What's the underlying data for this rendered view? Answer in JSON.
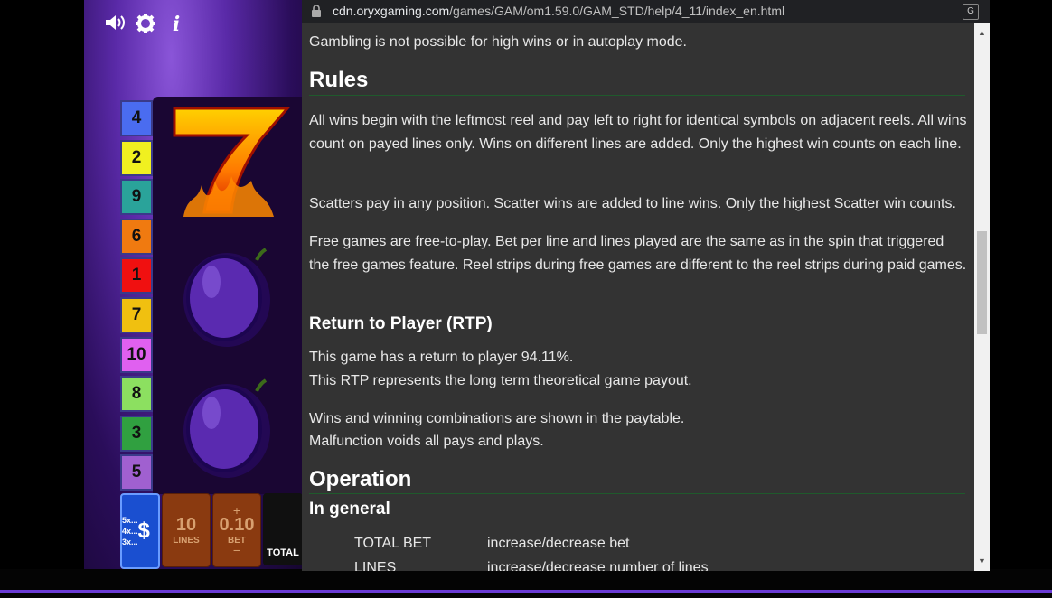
{
  "game": {
    "line_numbers": [
      {
        "label": "4",
        "color": "#4a6cf0"
      },
      {
        "label": "2",
        "color": "#f0f020"
      },
      {
        "label": "9",
        "color": "#2aa39a"
      },
      {
        "label": "6",
        "color": "#f07a10"
      },
      {
        "label": "1",
        "color": "#f01010"
      },
      {
        "label": "7",
        "color": "#f0c010"
      },
      {
        "label": "10",
        "color": "#e060f0"
      },
      {
        "label": "8",
        "color": "#8ce060"
      },
      {
        "label": "3",
        "color": "#30a040"
      },
      {
        "label": "5",
        "color": "#a060d0"
      }
    ],
    "gamble_multipliers": [
      "5x...",
      "4x...",
      "3x..."
    ],
    "lines_value": "10",
    "lines_label": "LINES",
    "bet_value": "0.10",
    "bet_label": "BET",
    "total_label": "TOTAL",
    "top_icons": [
      "speaker-icon",
      "gear-icon",
      "info-icon"
    ]
  },
  "browser": {
    "url_domain": "cdn.oryxgaming.com",
    "url_path": "/games/GAM/om1.59.0/GAM_STD/help/4_11/index_en.html"
  },
  "help": {
    "intro": "Gambling is not possible for high wins or in autoplay mode.",
    "rules_heading": "Rules",
    "rules_p1": "All wins begin with the leftmost reel and pay left to right for identical symbols on adjacent reels. All wins count on payed lines only. Wins on different lines are added. Only the highest win counts on each line.",
    "rules_p2": "Scatters pay in any position. Scatter wins are added to line wins. Only the highest Scatter win counts.",
    "rules_p3": "Free games are free-to-play. Bet per line and lines played are the same as in the spin that triggered the free games feature. Reel strips during free games are different to the reel strips during paid games.",
    "rtp_heading": "Return to Player (RTP)",
    "rtp_line1": "This game has a return to player 94.11%.",
    "rtp_line2": "This RTP represents the long term theoretical game payout.",
    "wins_line1": "Wins and winning combinations are shown in the paytable.",
    "wins_line2": "Malfunction voids all pays and plays.",
    "operation_heading": "Operation",
    "general_heading": "In general",
    "controls": [
      {
        "key": "TOTAL BET",
        "desc": "increase/decrease bet"
      },
      {
        "key": "LINES",
        "desc": "increase/decrease number of lines"
      }
    ]
  }
}
